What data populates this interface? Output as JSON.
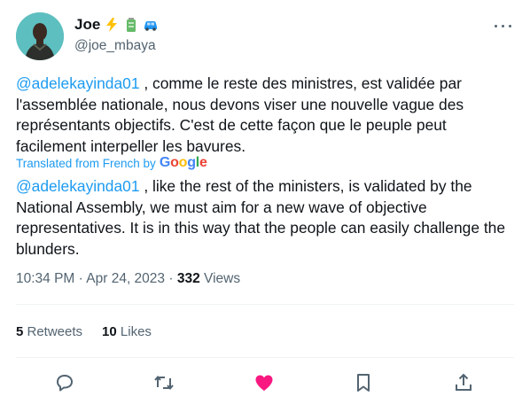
{
  "author": {
    "display_name": "Joe",
    "handle": "@joe_mbaya",
    "emoji": [
      "lightning-emoji",
      "battery-emoji",
      "car-emoji"
    ]
  },
  "tweet": {
    "mention": "@adelekayinda01",
    "text_rest": " , comme le reste des ministres, est validée par l'assemblée nationale, nous devons viser une nouvelle vague des représentants objectifs. C'est de cette façon que le peuple peut facilement interpeller les bavures."
  },
  "translation": {
    "label": "Translated from French by",
    "provider": "Google",
    "mention": "@adelekayinda01",
    "text_rest": " , like the rest of the ministers, is validated by the National Assembly, we must aim for a new wave of objective representatives. It is in this way that the people can easily challenge the blunders."
  },
  "meta": {
    "time": "10:34 PM",
    "sep1": " · ",
    "date": "Apr 24, 2023",
    "sep2": " · ",
    "views_count": "332",
    "views_label": " Views"
  },
  "stats": {
    "retweets_count": "5",
    "retweets_label": " Retweets",
    "likes_count": "10",
    "likes_label": " Likes"
  },
  "actions": {
    "icons": [
      "reply-icon",
      "retweet-icon",
      "like-icon",
      "bookmark-icon",
      "share-icon"
    ],
    "like_color": "#f91880",
    "icon_color": "#536471"
  },
  "colors": {
    "accent": "#1d9bf0",
    "secondary_text": "#536471"
  }
}
